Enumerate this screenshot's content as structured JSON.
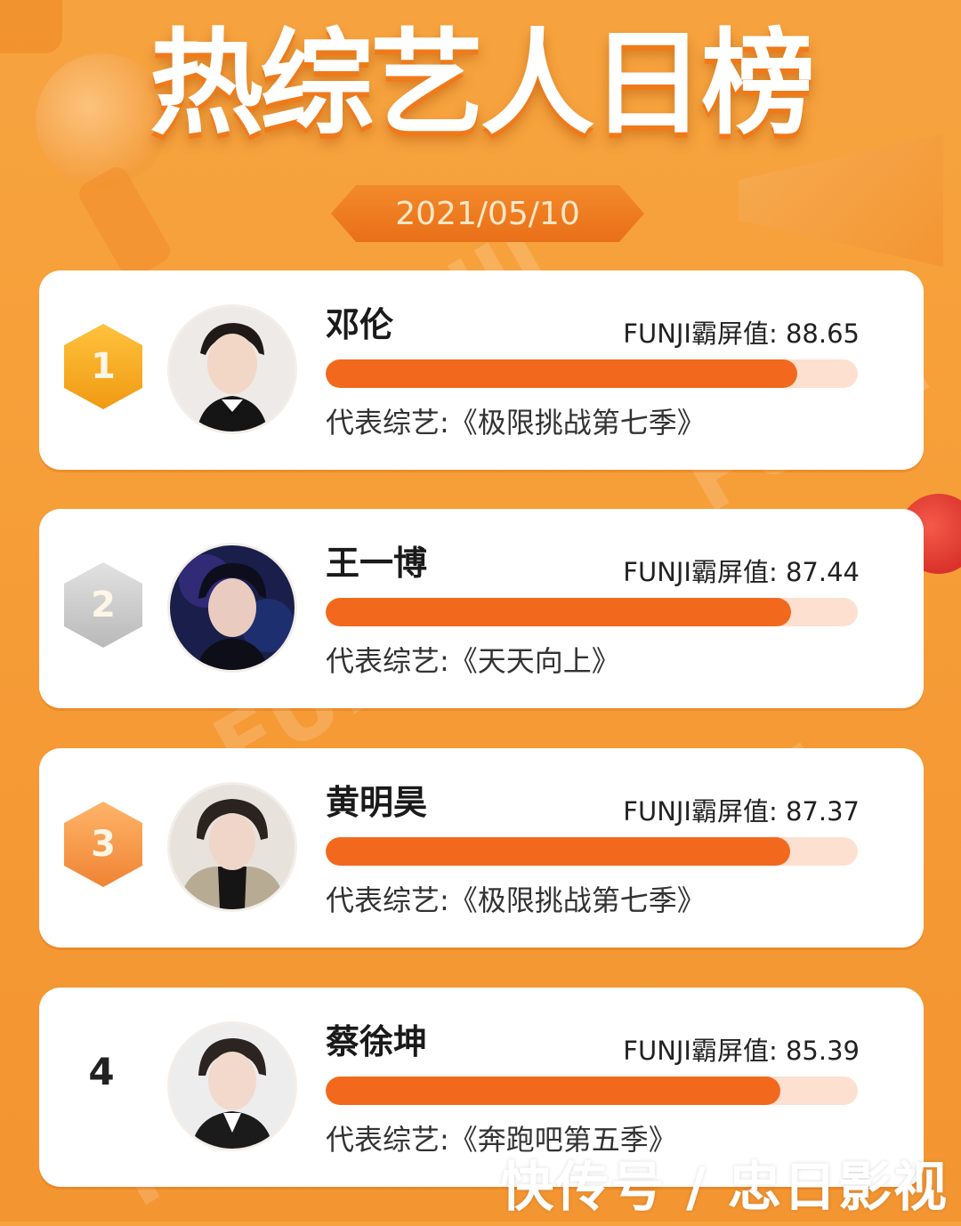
{
  "header": {
    "title": "热综艺人日榜",
    "date": "2021/05/10"
  },
  "rankings": [
    {
      "rank": "1",
      "name": "邓伦",
      "score_label": "FUNJI霸屏值: 88.65",
      "score": 88.65,
      "show": "代表综艺:《极限挑战第七季》"
    },
    {
      "rank": "2",
      "name": "王一博",
      "score_label": "FUNJI霸屏值: 87.44",
      "score": 87.44,
      "show": "代表综艺:《天天向上》"
    },
    {
      "rank": "3",
      "name": "黄明昊",
      "score_label": "FUNJI霸屏值: 87.37",
      "score": 87.37,
      "show": "代表综艺:《极限挑战第七季》"
    },
    {
      "rank": "4",
      "name": "蔡徐坤",
      "score_label": "FUNJI霸屏值: 85.39",
      "score": 85.39,
      "show": "代表综艺:《奔跑吧第五季》"
    }
  ],
  "watermark": {
    "brand": "FUNJI",
    "footer": "快传号 / 忠日影视"
  },
  "colors": {
    "background": "#f6a33f",
    "bar_fill": "#f2691d",
    "bar_track": "#fde0d0",
    "gold": "#f09a12",
    "silver": "#b9b9b9",
    "bronze": "#ef8433"
  }
}
